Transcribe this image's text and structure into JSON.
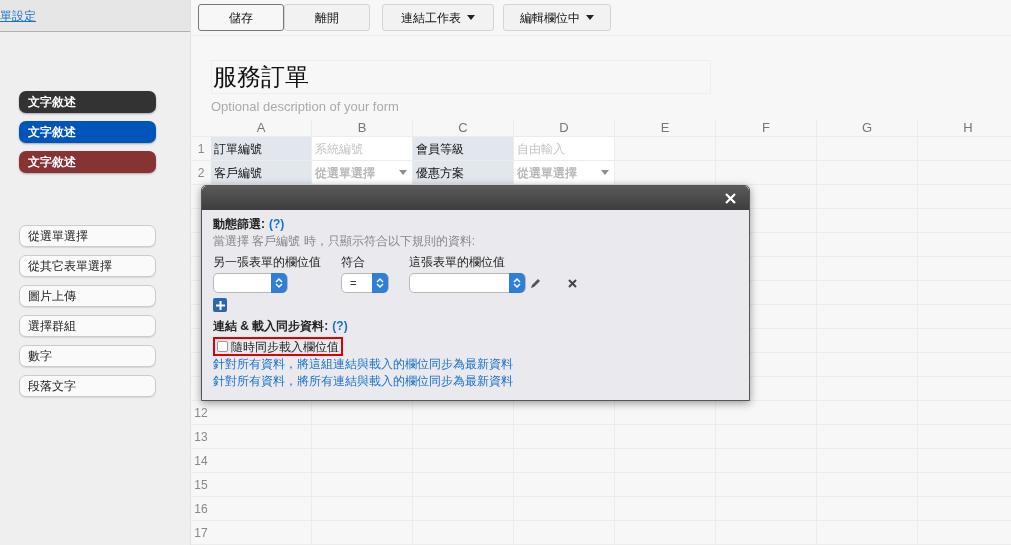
{
  "sidebar": {
    "link": "單設定",
    "color_buttons": [
      {
        "label": "文字敘述",
        "color": "#333333"
      },
      {
        "label": "文字敘述",
        "color": "#0055bb"
      },
      {
        "label": "文字敘述",
        "color": "#883333"
      }
    ],
    "field_types": [
      "從選單選擇",
      "從其它表單選擇",
      "圖片上傳",
      "選擇群組",
      "數字",
      "段落文字"
    ]
  },
  "toolbar": {
    "buttons": [
      {
        "label": "儲存",
        "kind": "plain",
        "focused": true
      },
      {
        "label": "離開",
        "kind": "plain",
        "focused": false
      },
      {
        "label": "連結工作表",
        "kind": "dropdown",
        "focused": false
      },
      {
        "label": "編輯欄位中",
        "kind": "dropdown",
        "focused": false
      }
    ]
  },
  "form": {
    "title": "服務訂單",
    "description_placeholder": "Optional description of your form"
  },
  "sheet": {
    "columns": [
      "A",
      "B",
      "C",
      "D",
      "E",
      "F",
      "G",
      "H"
    ],
    "rows": [
      {
        "number": "1",
        "cells": [
          {
            "text": "訂單編號",
            "kind": "label"
          },
          {
            "text": "系統編號",
            "kind": "hint"
          },
          {
            "text": "會員等級",
            "kind": "label"
          },
          {
            "text": "自由輸入",
            "kind": "hint"
          }
        ]
      },
      {
        "number": "2",
        "cells": [
          {
            "text": "客戶編號",
            "kind": "label"
          },
          {
            "text": "從選單選擇",
            "kind": "select"
          },
          {
            "text": "優惠方案",
            "kind": "label"
          },
          {
            "text": "從選單選擇",
            "kind": "select"
          }
        ]
      }
    ],
    "rows_below": [
      "12",
      "13",
      "14",
      "15",
      "16",
      "17"
    ]
  },
  "dialog": {
    "filter_title": "動態篩選:",
    "filter_help": "(?)",
    "filter_desc": "當選擇 客戶編號 時，只顯示符合以下規則的資料:",
    "rule_columns": [
      "另一張表單的欄位值",
      "符合",
      "這張表單的欄位值"
    ],
    "operator": "=",
    "sync_title": "連結 & 載入同步資料:",
    "sync_help": "(?)",
    "sync_checkbox": {
      "label": "隨時同步載入欄位值",
      "checked": false,
      "highlighted": true
    },
    "links": [
      "針對所有資料，將這組連結與載入的欄位同步為最新資料",
      "針對所有資料，將所有連結與載入的欄位同步為最新資料"
    ]
  }
}
